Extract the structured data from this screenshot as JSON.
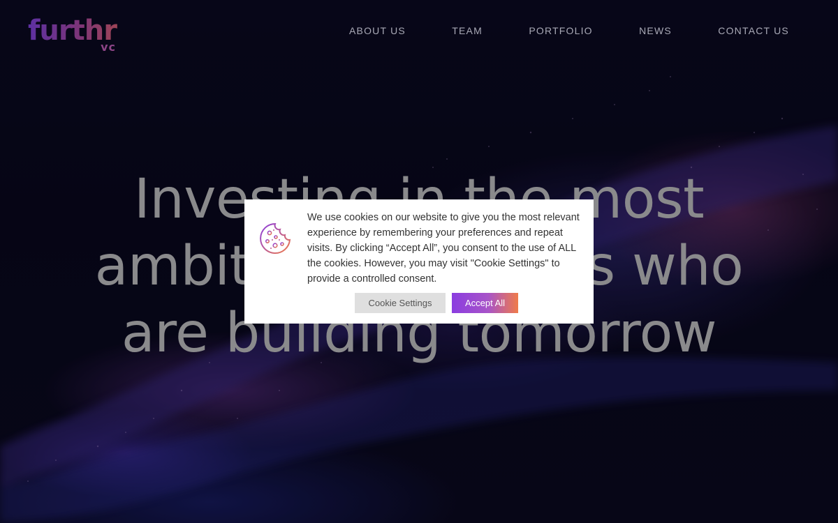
{
  "brand": {
    "logo_word": "furthr",
    "logo_sub": "vc"
  },
  "nav": {
    "items": [
      "ABOUT US",
      "TEAM",
      "PORTFOLIO",
      "NEWS",
      "CONTACT US"
    ]
  },
  "hero": {
    "line1": "Investing in the most",
    "line2": "ambitious founders who",
    "line3": "are building tomorrow"
  },
  "cookie": {
    "icon": "cookie-icon",
    "message": "We use cookies on our website to give you the most relevant experience by remembering your preferences and repeat visits. By clicking “Accept All”, you consent to the use of ALL the cookies. However, you may visit \"Cookie Settings\" to provide a controlled consent.",
    "settings_label": "Cookie Settings",
    "accept_label": "Accept All"
  },
  "colors": {
    "accent_start": "#8b3de0",
    "accent_end": "#ef7b4a",
    "background": "#08061a"
  }
}
